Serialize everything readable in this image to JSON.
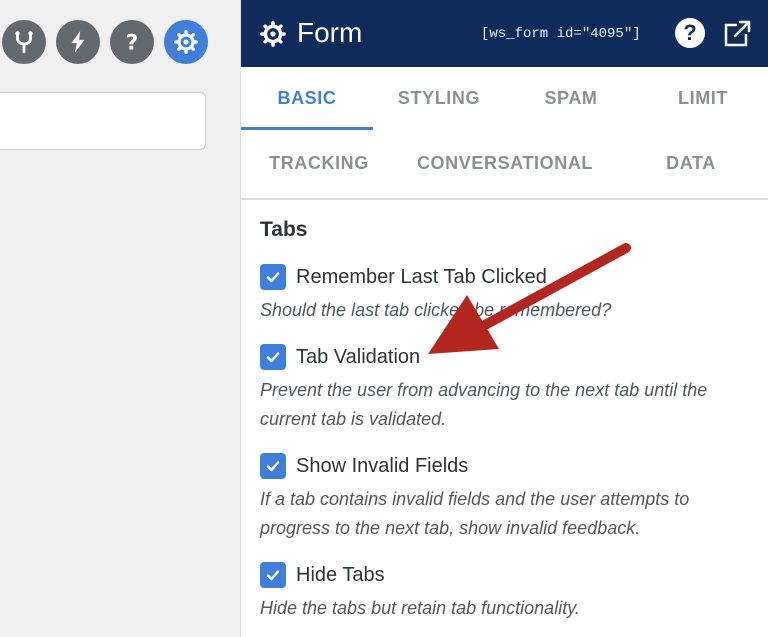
{
  "sidebar": {
    "title": "Form",
    "shortcode": "[ws_form id=\"4095\"]",
    "help_label": "?"
  },
  "tabs": [
    {
      "label": "BASIC",
      "active": true
    },
    {
      "label": "STYLING",
      "active": false
    },
    {
      "label": "SPAM",
      "active": false
    },
    {
      "label": "LIMIT",
      "active": false
    },
    {
      "label": "TRACKING",
      "active": false
    },
    {
      "label": "CONVERSATIONAL",
      "active": false
    },
    {
      "label": "DATA",
      "active": false
    }
  ],
  "section": {
    "title": "Tabs",
    "options": [
      {
        "label": "Remember Last Tab Clicked",
        "checked": true,
        "description": "Should the last tab clicked be remembered?"
      },
      {
        "label": "Tab Validation",
        "checked": true,
        "description": "Prevent the user from advancing to the next tab until the current tab is validated."
      },
      {
        "label": "Show Invalid Fields",
        "checked": true,
        "description": "If a tab contains invalid fields and the user attempts to progress to the next tab, show invalid feedback."
      },
      {
        "label": "Hide Tabs",
        "checked": true,
        "description": "Hide the tabs but retain tab functionality."
      }
    ]
  },
  "toolbar": {
    "icons": [
      "branch-icon",
      "bolt-icon",
      "help-icon",
      "gear-icon"
    ],
    "active_icon": "gear-icon"
  },
  "colors": {
    "header_bg": "#0e2b5c",
    "accent": "#3f7fd9",
    "annotation_arrow": "#b3271f"
  }
}
